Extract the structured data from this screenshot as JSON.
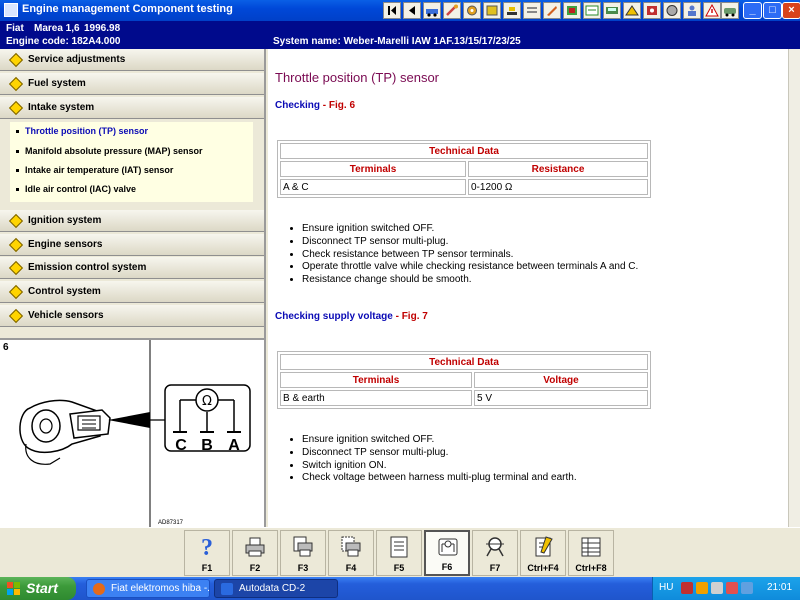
{
  "window": {
    "title": "Engine management Component testing",
    "toolbar_icons": [
      "first-page-icon",
      "prev-page-icon",
      "vehicle-icon",
      "wrench-icon",
      "tools-icon",
      "stop-icon",
      "parts-icon",
      "tool-icon",
      "settings-icon",
      "image-icon",
      "chart-icon",
      "car-icon",
      "book-icon",
      "disc-icon",
      "person-icon",
      "camera-icon",
      "warning-icon",
      "car-front-icon"
    ],
    "controls": {
      "minimize": "_",
      "maximize": "□",
      "close": "×"
    }
  },
  "vehicle": {
    "make": "Fiat",
    "model": "Marea 1,6",
    "years": "1996.98",
    "engine_code": "Engine code: 182A4.000",
    "system_name": "System name: Weber-Marelli IAW 1AF.13/15/17/23/25"
  },
  "sidebar": {
    "sections": [
      {
        "label": "Service adjustments"
      },
      {
        "label": "Fuel system"
      },
      {
        "label": "Intake system",
        "expanded": true
      },
      {
        "label": "Ignition system"
      },
      {
        "label": "Engine sensors"
      },
      {
        "label": "Emission control system"
      },
      {
        "label": "Control system"
      },
      {
        "label": "Vehicle sensors"
      }
    ],
    "intake_items": [
      {
        "label": "Throttle position (TP) sensor",
        "active": true
      },
      {
        "label": "Manifold absolute pressure (MAP) sensor"
      },
      {
        "label": "Intake air temperature (IAT) sensor"
      },
      {
        "label": "Idle air control (IAC) valve"
      }
    ]
  },
  "figure": {
    "number": "6",
    "ohm_symbol": "Ω",
    "terminals": [
      "C",
      "B",
      "A"
    ],
    "code": "AD87317"
  },
  "content": {
    "title": "Throttle position (TP) sensor",
    "check1": {
      "heading": "Checking",
      "fig": "- Fig. 6",
      "table": {
        "title": "Technical Data",
        "col1": "Terminals",
        "col2": "Resistance",
        "rows": [
          [
            "A & C",
            "0-1200 Ω"
          ]
        ]
      },
      "steps": [
        "Ensure ignition switched OFF.",
        "Disconnect TP sensor multi-plug.",
        "Check resistance between TP sensor terminals.",
        "Operate throttle valve while checking resistance between terminals A and C.",
        "Resistance change should be smooth."
      ]
    },
    "check2": {
      "heading": "Checking supply voltage",
      "fig": "- Fig. 7",
      "table": {
        "title": "Technical Data",
        "col1": "Terminals",
        "col2": "Voltage",
        "rows": [
          [
            "B & earth",
            "5 V"
          ]
        ]
      },
      "steps": [
        "Ensure ignition switched OFF.",
        "Disconnect TP sensor multi-plug.",
        "Switch ignition ON.",
        "Check voltage between harness multi-plug terminal and earth."
      ]
    }
  },
  "function_keys": [
    {
      "label": "F1",
      "icon": "help-icon"
    },
    {
      "label": "F2",
      "icon": "print-icon"
    },
    {
      "label": "F3",
      "icon": "print-pages-icon"
    },
    {
      "label": "F4",
      "icon": "print-selection-icon"
    },
    {
      "label": "F5",
      "icon": "document-icon"
    },
    {
      "label": "F6",
      "icon": "wiring-diagram-icon",
      "pressed": true
    },
    {
      "label": "F7",
      "icon": "component-location-icon"
    },
    {
      "label": "Ctrl+F4",
      "icon": "notes-icon"
    },
    {
      "label": "Ctrl+F8",
      "icon": "table-icon"
    }
  ],
  "taskbar": {
    "start": "Start",
    "tasks": [
      {
        "label": "Fiat elektromos hiba -..."
      },
      {
        "label": "Autodata CD-2"
      }
    ],
    "tray": {
      "language": "HU",
      "time": "21:01"
    }
  },
  "colors": {
    "title_bar": "#0048d8",
    "info_bar": "#000a8c",
    "heading_blue": "#0a0ab5",
    "figure_red": "#c00000",
    "title_maroon": "#7a0a52",
    "submenu_bg": "#ffffe3",
    "start_green": "#3c9a3a"
  }
}
